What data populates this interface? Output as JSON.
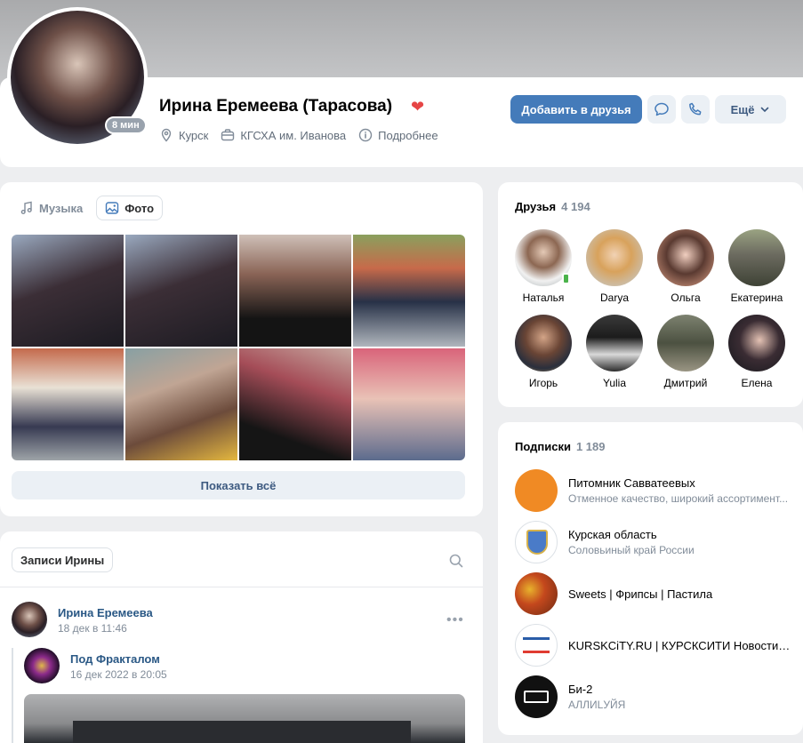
{
  "profile": {
    "name": "Ирина Еремеева (Тарасова)",
    "online": "8 мин",
    "city": "Курск",
    "education": "КГСХА им. Иванова",
    "more_info": "Подробнее"
  },
  "actions": {
    "add_friend": "Добавить в друзья",
    "more": "Ещё"
  },
  "media_tabs": [
    {
      "label": "Музыка",
      "active": false
    },
    {
      "label": "Фото",
      "active": true
    }
  ],
  "photos_show_all": "Показать всё",
  "friends": {
    "title": "Друзья",
    "count": "4 194",
    "items": [
      {
        "name": "Наталья"
      },
      {
        "name": "Darya"
      },
      {
        "name": "Ольга"
      },
      {
        "name": "Екатерина"
      },
      {
        "name": "Игорь"
      },
      {
        "name": "Yulia"
      },
      {
        "name": "Дмитрий"
      },
      {
        "name": "Елена"
      }
    ]
  },
  "subscriptions": {
    "title": "Подписки",
    "count": "1 189",
    "items": [
      {
        "name": "Питомник Савватеевых",
        "desc": "Отменное качество, широкий ассортимент..."
      },
      {
        "name": "Курская область",
        "desc": "Соловьиный край России"
      },
      {
        "name": "Sweets | Фрипсы | Пастила",
        "desc": ""
      },
      {
        "name": "KURSKCiTY.RU | КУРСКСИТИ Новости Курска",
        "desc": ""
      },
      {
        "name": "Би-2",
        "desc": "АЛЛИLУЙЯ"
      }
    ]
  },
  "wall": {
    "tab": "Записи Ирины",
    "post": {
      "author": "Ирина Еремеева",
      "date": "18 дек в 11:46",
      "repost_author": "Под Фракталом",
      "repost_date": "16 дек 2022 в 20:05"
    }
  },
  "colors": {
    "accent": "#447bba",
    "link": "#2a5885",
    "secondary_text": "#818c99"
  }
}
